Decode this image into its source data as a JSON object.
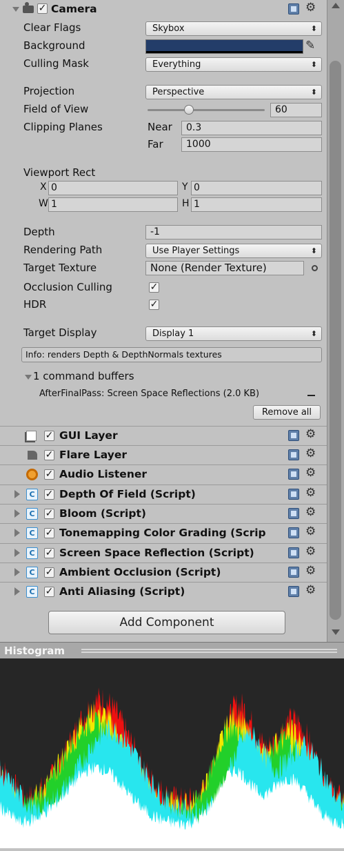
{
  "camera": {
    "title": "Camera",
    "clear_flags": {
      "label": "Clear Flags",
      "value": "Skybox"
    },
    "background": {
      "label": "Background",
      "color": "#233d69"
    },
    "culling_mask": {
      "label": "Culling Mask",
      "value": "Everything"
    },
    "projection": {
      "label": "Projection",
      "value": "Perspective"
    },
    "field_of_view": {
      "label": "Field of View",
      "value": "60",
      "slider_fraction": 0.35
    },
    "clipping": {
      "label": "Clipping Planes",
      "near_label": "Near",
      "near": "0.3",
      "far_label": "Far",
      "far": "1000"
    },
    "viewport": {
      "label": "Viewport Rect",
      "x_label": "X",
      "x": "0",
      "y_label": "Y",
      "y": "0",
      "w_label": "W",
      "w": "1",
      "h_label": "H",
      "h": "1"
    },
    "depth": {
      "label": "Depth",
      "value": "-1"
    },
    "rendering_path": {
      "label": "Rendering Path",
      "value": "Use Player Settings"
    },
    "target_texture": {
      "label": "Target Texture",
      "value": "None (Render Texture)"
    },
    "occlusion_culling": {
      "label": "Occlusion Culling",
      "checked": true
    },
    "hdr": {
      "label": "HDR",
      "checked": true
    },
    "target_display": {
      "label": "Target Display",
      "value": "Display 1"
    },
    "info": "Info: renders Depth & DepthNormals textures",
    "command_buffers": {
      "header": "1 command buffers",
      "item": "AfterFinalPass: Screen Space Reflections (2.0 KB)",
      "remove_all": "Remove all"
    }
  },
  "components": [
    {
      "name": "GUI Layer",
      "icon": "gui-layer-icon",
      "foldable": false
    },
    {
      "name": "Flare Layer",
      "icon": "flare-layer-icon",
      "foldable": false
    },
    {
      "name": "Audio Listener",
      "icon": "audio-listener-icon",
      "foldable": false
    },
    {
      "name": "Depth Of Field (Script)",
      "icon": "script-icon",
      "foldable": true
    },
    {
      "name": "Bloom (Script)",
      "icon": "script-icon",
      "foldable": true
    },
    {
      "name": "Tonemapping Color Grading (Scrip",
      "icon": "script-icon",
      "foldable": true
    },
    {
      "name": "Screen Space Reflection (Script)",
      "icon": "script-icon",
      "foldable": true
    },
    {
      "name": "Ambient Occlusion (Script)",
      "icon": "script-icon",
      "foldable": true
    },
    {
      "name": "Anti Aliasing (Script)",
      "icon": "script-icon",
      "foldable": true
    }
  ],
  "add_component": "Add Component",
  "histogram": {
    "title": "Histogram"
  }
}
